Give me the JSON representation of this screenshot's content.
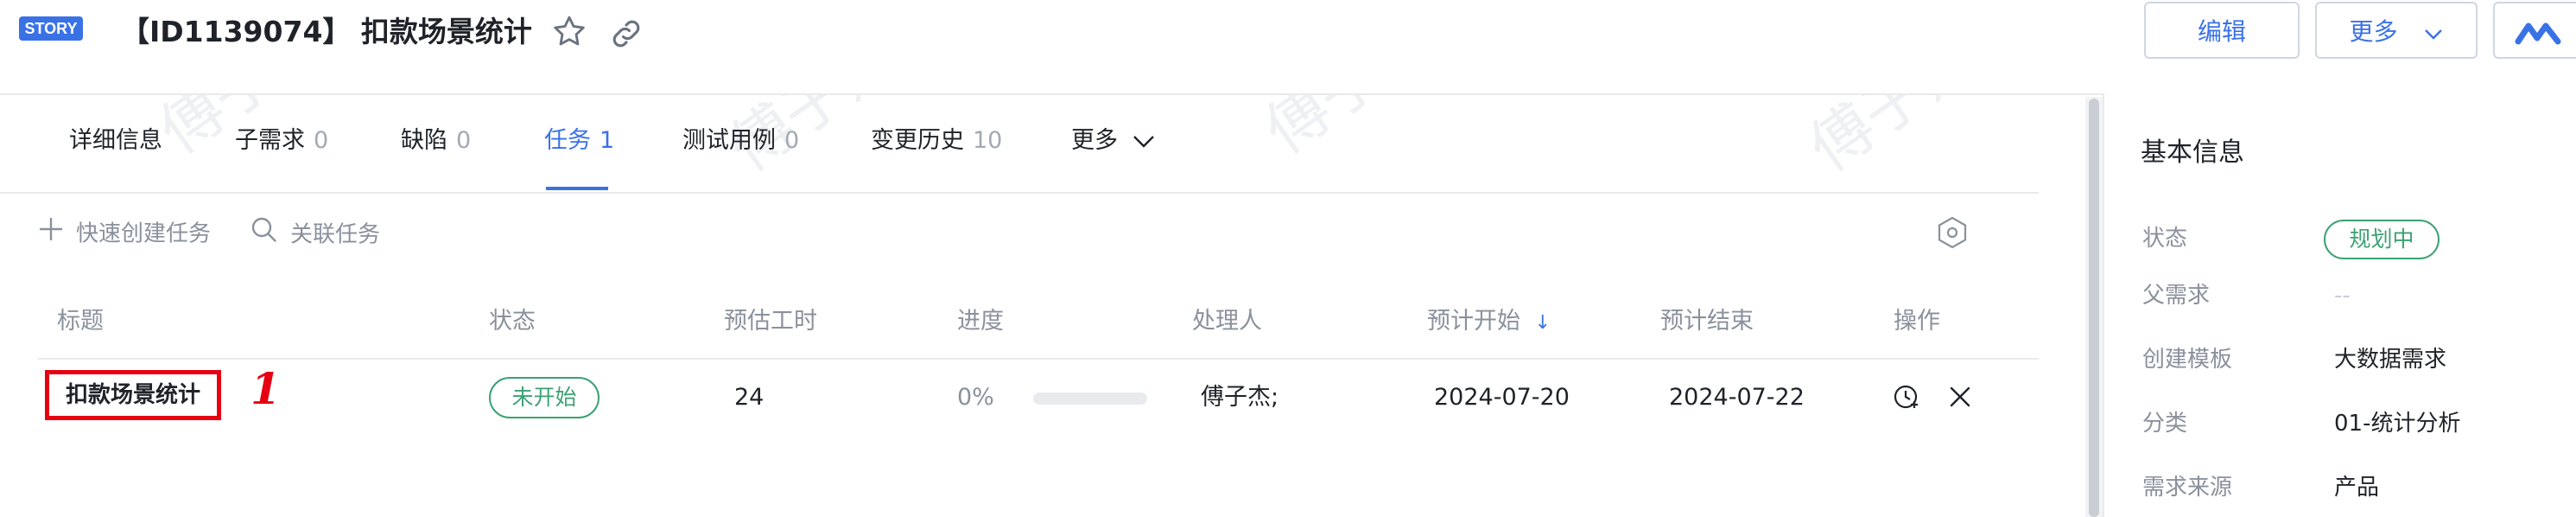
{
  "header": {
    "tag": "STORY",
    "title": "【ID1139074】 扣款场景统计",
    "edit_label": "编辑",
    "more_label": "更多",
    "star_icon": "star-outline-icon",
    "link_icon": "link-icon"
  },
  "tabs": [
    {
      "label": "详细信息",
      "count": ""
    },
    {
      "label": "子需求",
      "count": "0"
    },
    {
      "label": "缺陷",
      "count": "0"
    },
    {
      "label": "任务",
      "count": "1"
    },
    {
      "label": "测试用例",
      "count": "0"
    },
    {
      "label": "变更历史",
      "count": "10"
    },
    {
      "label": "更多",
      "count": ""
    }
  ],
  "toolbar": {
    "quick_create_label": "快速创建任务",
    "link_task_label": "关联任务",
    "settings_icon": "hexagon-settings-icon"
  },
  "table": {
    "columns": [
      "标题",
      "状态",
      "预估工时",
      "进度",
      "处理人",
      "预计开始",
      "预计结束",
      "操作"
    ],
    "sort_indicator": "↓",
    "rows": [
      {
        "title": "扣款场景统计",
        "status": "未开始",
        "estimate": "24",
        "progress_text": "0%",
        "progress_value": 0,
        "assignee": "傅子杰;",
        "start": "2024-07-20",
        "end": "2024-07-22"
      }
    ]
  },
  "annotation": "1",
  "right_panel": {
    "title": "基本信息",
    "fields": [
      {
        "label": "状态",
        "value": "规划中"
      },
      {
        "label": "父需求",
        "value": "--"
      },
      {
        "label": "创建模板",
        "value": "大数据需求"
      },
      {
        "label": "分类",
        "value": "01-统计分析"
      },
      {
        "label": "需求来源",
        "value": "产品"
      }
    ]
  },
  "watermark": "傅子杰",
  "colors": {
    "accent": "#3a72e6",
    "status_green": "#3ba272",
    "annotation_red": "#e60012"
  }
}
